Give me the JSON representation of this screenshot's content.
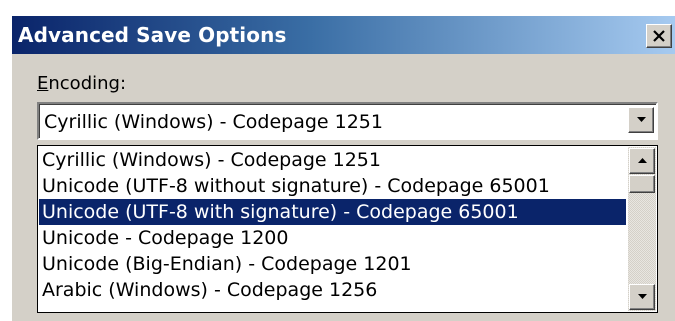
{
  "dialog": {
    "title": "Advanced Save Options",
    "close_icon": "close-icon"
  },
  "encoding": {
    "label_mnemonic": "E",
    "label_rest": "ncoding:",
    "selected_value": "Cyrillic (Windows) - Codepage 1251",
    "dropdown_icon": "chevron-down-icon"
  },
  "options": [
    {
      "label": "Cyrillic (Windows) - Codepage 1251",
      "selected": false
    },
    {
      "label": "Unicode (UTF-8 without signature) - Codepage 65001",
      "selected": false
    },
    {
      "label": "Unicode (UTF-8 with signature) - Codepage 65001",
      "selected": true
    },
    {
      "label": "Unicode - Codepage 1200",
      "selected": false
    },
    {
      "label": "Unicode (Big-Endian) - Codepage 1201",
      "selected": false
    },
    {
      "label": "Arabic (Windows) - Codepage 1256",
      "selected": false
    }
  ],
  "colors": {
    "title_bar_start": "#0a246a",
    "title_bar_end": "#a6caf0",
    "selection_background": "#0a246a",
    "face": "#d4d0c8"
  }
}
